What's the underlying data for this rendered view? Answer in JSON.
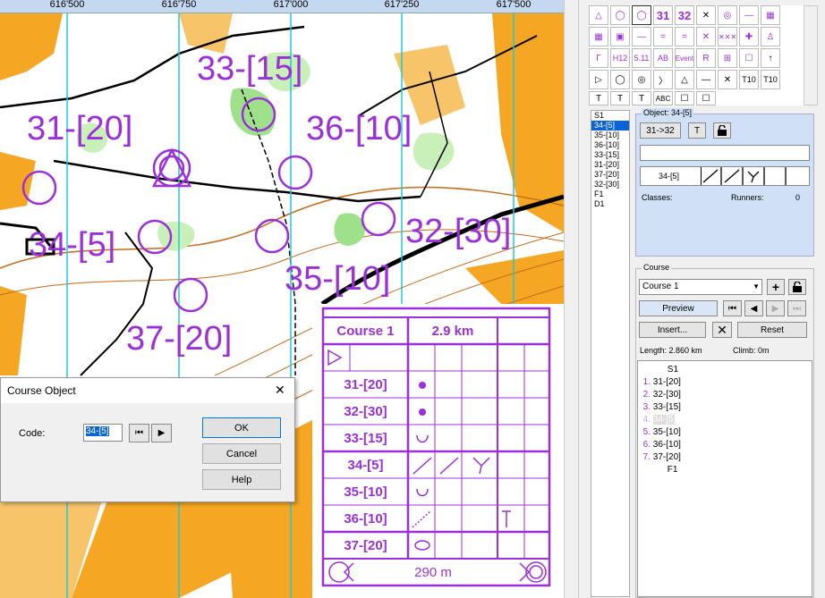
{
  "map": {
    "ruler_ticks": [
      "616'500",
      "616'750",
      "617'000",
      "617'250",
      "617'500"
    ],
    "controls": [
      {
        "label": "33-[15]"
      },
      {
        "label": "31-[20]"
      },
      {
        "label": "36-[10]"
      },
      {
        "label": "34-[5]"
      },
      {
        "label": "32-[30]"
      },
      {
        "label": "35-[10]"
      },
      {
        "label": "37-[20]"
      }
    ]
  },
  "palette": {
    "row1": [
      "△",
      "◯",
      "◯",
      "31",
      "32",
      "✕",
      "◎",
      "—",
      "▦"
    ],
    "row2": [
      "▦",
      "▣",
      "—",
      "=",
      "=",
      "✕",
      "✕✕✕",
      "✚",
      "♙"
    ],
    "row3": [
      "Γ",
      "H12",
      "5.11",
      "AB",
      "Event",
      "R",
      "⊞",
      "☐",
      "↑"
    ],
    "row4": [
      "▷",
      "◯",
      "◎",
      "〉",
      "△",
      "—",
      "✕",
      "T10",
      "T10"
    ],
    "row5": [
      "T",
      "T",
      "T",
      "ABC",
      "☐",
      "☐",
      "",
      "",
      ""
    ]
  },
  "control_list": [
    "S1",
    "34-[5]",
    "35-[10]",
    "36-[10]",
    "33-[15]",
    "31-[20]",
    "37-[20]",
    "32-[30]",
    "F1",
    "D1"
  ],
  "object_panel": {
    "title": "Object: 34-[5]",
    "button_range": "31->32",
    "button_t": "T",
    "code_preview": "34-[5]",
    "classes_label": "Classes:",
    "runners_label": "Runners:",
    "runners_value": "0"
  },
  "course_panel": {
    "title": "Course",
    "selected_course": "Course 1",
    "preview_label": "Preview",
    "insert_label": "Insert...",
    "reset_label": "Reset",
    "length_text": "Length: 2.860 km",
    "climb_text": "Climb: 0m",
    "items": [
      {
        "num": "",
        "label": "S1"
      },
      {
        "num": "1.",
        "label": "31-[20]"
      },
      {
        "num": "2.",
        "label": "32-[30]"
      },
      {
        "num": "3.",
        "label": "33-[15]"
      },
      {
        "num": "4.",
        "label": "34-[5]"
      },
      {
        "num": "5.",
        "label": "35-[10]"
      },
      {
        "num": "6.",
        "label": "36-[10]"
      },
      {
        "num": "7.",
        "label": "37-[20]"
      },
      {
        "num": "",
        "label": "F1"
      }
    ]
  },
  "dialog": {
    "title": "Course Object",
    "code_label": "Code:",
    "code_value": "34-[5]",
    "ok_label": "OK",
    "cancel_label": "Cancel",
    "help_label": "Help",
    "close_glyph": "✕",
    "first_glyph": "⏮",
    "next_glyph": "▶"
  },
  "description_sheet": {
    "course_name": "Course 1",
    "length": "2.9 km",
    "rows": [
      "31-[20]",
      "32-[30]",
      "33-[15]",
      "34-[5]",
      "35-[10]",
      "36-[10]",
      "37-[20]"
    ],
    "finish_distance": "290 m"
  },
  "colors": {
    "accent": "#9b30d9",
    "selection": "#0a64d8",
    "panel": "#cfe0f7"
  }
}
